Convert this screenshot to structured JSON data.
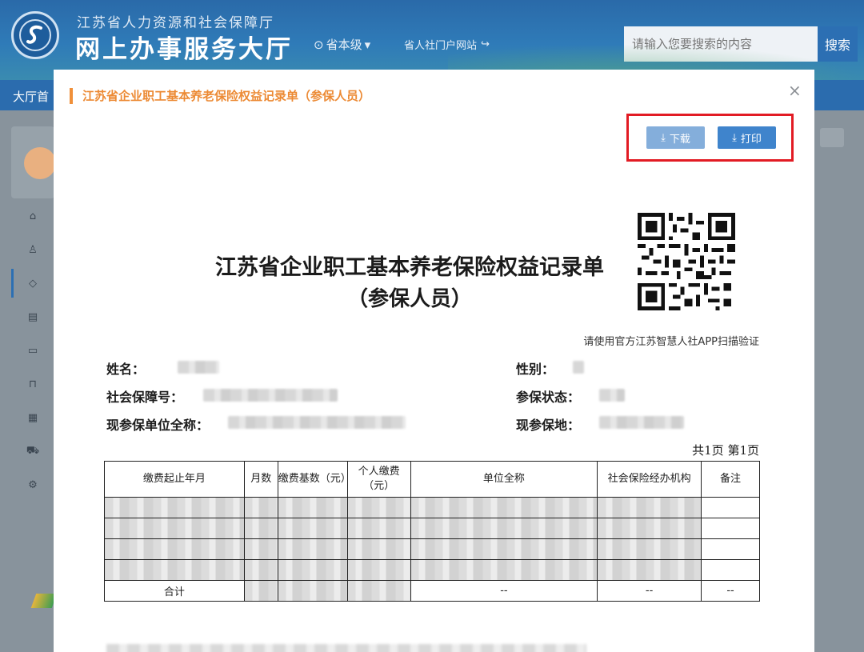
{
  "site": {
    "org_name": "江苏省人力资源和社会保障厅",
    "hall_name": "网上办事服务大厅",
    "region": "省本级",
    "portal_link": "省人社门户网站",
    "search_placeholder": "请输入您要搜索的内容",
    "search_button": "搜索",
    "nav_home": "大厅首"
  },
  "modal": {
    "title": "江苏省企业职工基本养老保险权益记录单（参保人员）",
    "close": "×",
    "download_label": "下载",
    "print_label": "打印"
  },
  "document": {
    "title": "江苏省企业职工基本养老保险权益记录单",
    "subtitle": "（参保人员）",
    "qr_note": "请使用官方江苏智慧人社APP扫描验证",
    "fields": {
      "name": "姓名：",
      "gender": "性别：",
      "ss_number": "社会保障号：",
      "status": "参保状态：",
      "employer": "现参保单位全称：",
      "location": "现参保地："
    },
    "page_count": "共1页  第1页",
    "table": {
      "headers": [
        "缴费起止年月",
        "月数",
        "缴费基数（元）",
        "个人缴费（元）",
        "单位全称",
        "社会保险经办机构",
        "备注"
      ],
      "total_label": "合计",
      "total_unit": "--",
      "total_agency": "--",
      "total_remark": "--"
    }
  },
  "colors": {
    "accent_orange": "#ec8a34",
    "highlight_red": "#e21b24",
    "primary_blue": "#3f84cc"
  }
}
